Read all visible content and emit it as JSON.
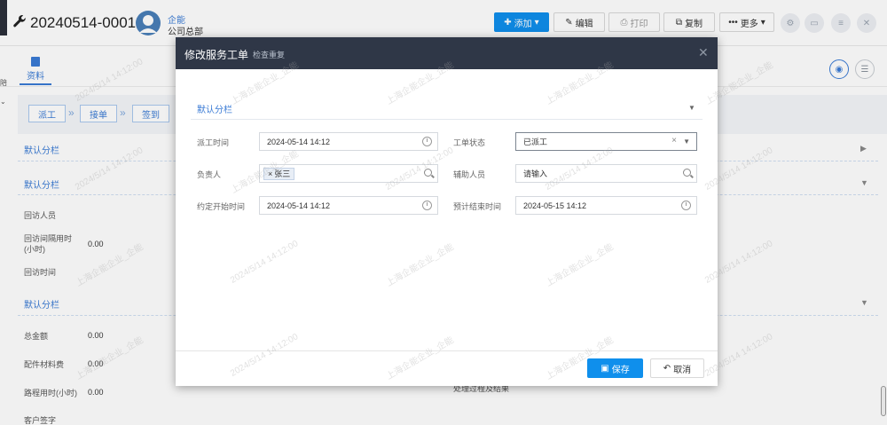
{
  "header": {
    "order_no": "20240514-0001",
    "user_name": "企能",
    "user_dept": "公司总部",
    "buttons": {
      "add": "添加",
      "edit": "编辑",
      "print": "打印",
      "copy": "复制",
      "more": "更多"
    }
  },
  "background": {
    "tab_label": "资料",
    "steps": [
      "派工",
      "接单",
      "签到"
    ],
    "sections": [
      "默认分栏",
      "默认分栏",
      "默认分栏"
    ],
    "fields": {
      "visit_person": "回访人员",
      "visit_interval": "回访间隔用时(小时)",
      "visit_interval_value": "0.00",
      "visit_time": "回访时间",
      "total_amount": "总金额",
      "total_amount_value": "0.00",
      "parts_cost": "配件材料费",
      "parts_cost_value": "0.00",
      "travel_time": "路程用时(小时)",
      "travel_time_value": "0.00",
      "customer_sign": "客户签字",
      "process_result": "处理过程及结果"
    }
  },
  "modal": {
    "title": "修改服务工单",
    "subtitle": "检查重复",
    "section": "默认分栏",
    "fields": {
      "dispatch_time_label": "派工时间",
      "dispatch_time": "2024-05-14 14:12",
      "status_label": "工单状态",
      "status": "已派工",
      "owner_label": "负责人",
      "owner_tag": "张三",
      "assistant_label": "辅助人员",
      "assistant_placeholder": "请输入",
      "start_label": "约定开始时间",
      "start_time": "2024-05-14 14:12",
      "end_label": "预计结束时间",
      "end_time": "2024-05-15 14:12"
    },
    "buttons": {
      "save": "保存",
      "cancel": "取消"
    }
  },
  "watermark": "上海企能企业_企能",
  "watermark_date": "2024/5/14 14:12:00"
}
